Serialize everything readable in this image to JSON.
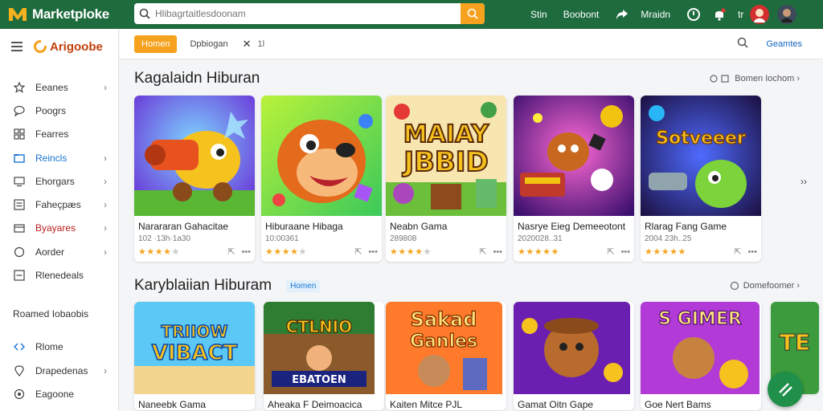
{
  "app": {
    "name": "Marketploke",
    "search_placeholder": "Hlibagrtaitlesdoonam"
  },
  "topnav": {
    "links": [
      "Stin",
      "Boobont",
      "Mraidn",
      "tr"
    ]
  },
  "sidebar": {
    "brand": "Arigoobe",
    "items": [
      {
        "label": "Eeanes",
        "chevron": "›"
      },
      {
        "label": "Poogrs",
        "chevron": ""
      },
      {
        "label": "Fearres",
        "chevron": ""
      },
      {
        "label": "Reincls",
        "chevron": "›"
      },
      {
        "label": "Ehorgars",
        "chevron": "›"
      },
      {
        "label": "Faheçpæs",
        "chevron": "›"
      },
      {
        "label": "Byayares",
        "chevron": "›"
      },
      {
        "label": "Aorder",
        "chevron": "›"
      },
      {
        "label": "Rlenedeals",
        "chevron": ""
      }
    ],
    "section_label": "Roamed Iobaobis",
    "bottom_items": [
      {
        "label": "Rlome",
        "chevron": ""
      },
      {
        "label": "Drapedenas",
        "chevron": "›"
      },
      {
        "label": "Eagoone",
        "chevron": ""
      }
    ]
  },
  "tabbar": {
    "active_tab": "Homen",
    "tab": "Dpbiogan",
    "close": "✕",
    "count": "1l",
    "right_label": "Geamtes"
  },
  "sections": [
    {
      "title": "Kagalaidn Hiburan",
      "badge": "",
      "more": "Bomen Iochom ›",
      "cards": [
        {
          "title": "Narararan Gahacitae",
          "sub": "102 ·13h·1a30",
          "rating": 4
        },
        {
          "title": "Hiburaane Hibaga",
          "sub": "10:00361",
          "rating": 4
        },
        {
          "title": "Neabn Gama",
          "sub": "289808",
          "rating": 4
        },
        {
          "title": "Nasrye Eieg Demeeotont",
          "sub": "2020028..31",
          "rating": 5
        },
        {
          "title": "Rlarag Fang Game",
          "sub": "2004 23h..25",
          "rating": 5
        }
      ],
      "next": "››"
    },
    {
      "title": "Karyblaiian Hiburam",
      "badge": "Homen",
      "more": "Domefoomer ›",
      "cards": [
        {
          "title": "Naneebk Gama"
        },
        {
          "title": "Aheaka F Deimoacica"
        },
        {
          "title": "Kaiten Mitce PJL"
        },
        {
          "title": "Gamat Oitn Gape"
        },
        {
          "title": "Goe Nert Bams"
        }
      ]
    }
  ],
  "art_text": {
    "row1_card3": [
      "MAIAY",
      "JBBID"
    ],
    "row1_card5": "Sotveeer",
    "row2_card1": [
      "TRIIOW",
      "VIBACT"
    ],
    "row2_card2": [
      "CTLNIO",
      "EBATOEN"
    ],
    "row2_card3": [
      "Sakad",
      "Ganles"
    ],
    "row2_card5": "S GIMER",
    "row2_card6": "TE"
  },
  "colors": {
    "topbar": "#1e6b3e",
    "accent": "#f6a21e",
    "link": "#1565c0",
    "star": "#f5a623"
  },
  "icons": [
    "search-icon",
    "share-icon",
    "help-icon",
    "bell-icon",
    "gear-icon",
    "hamburger-icon",
    "chevron-right-icon",
    "share-card-icon",
    "more-icon",
    "fab-icon"
  ]
}
